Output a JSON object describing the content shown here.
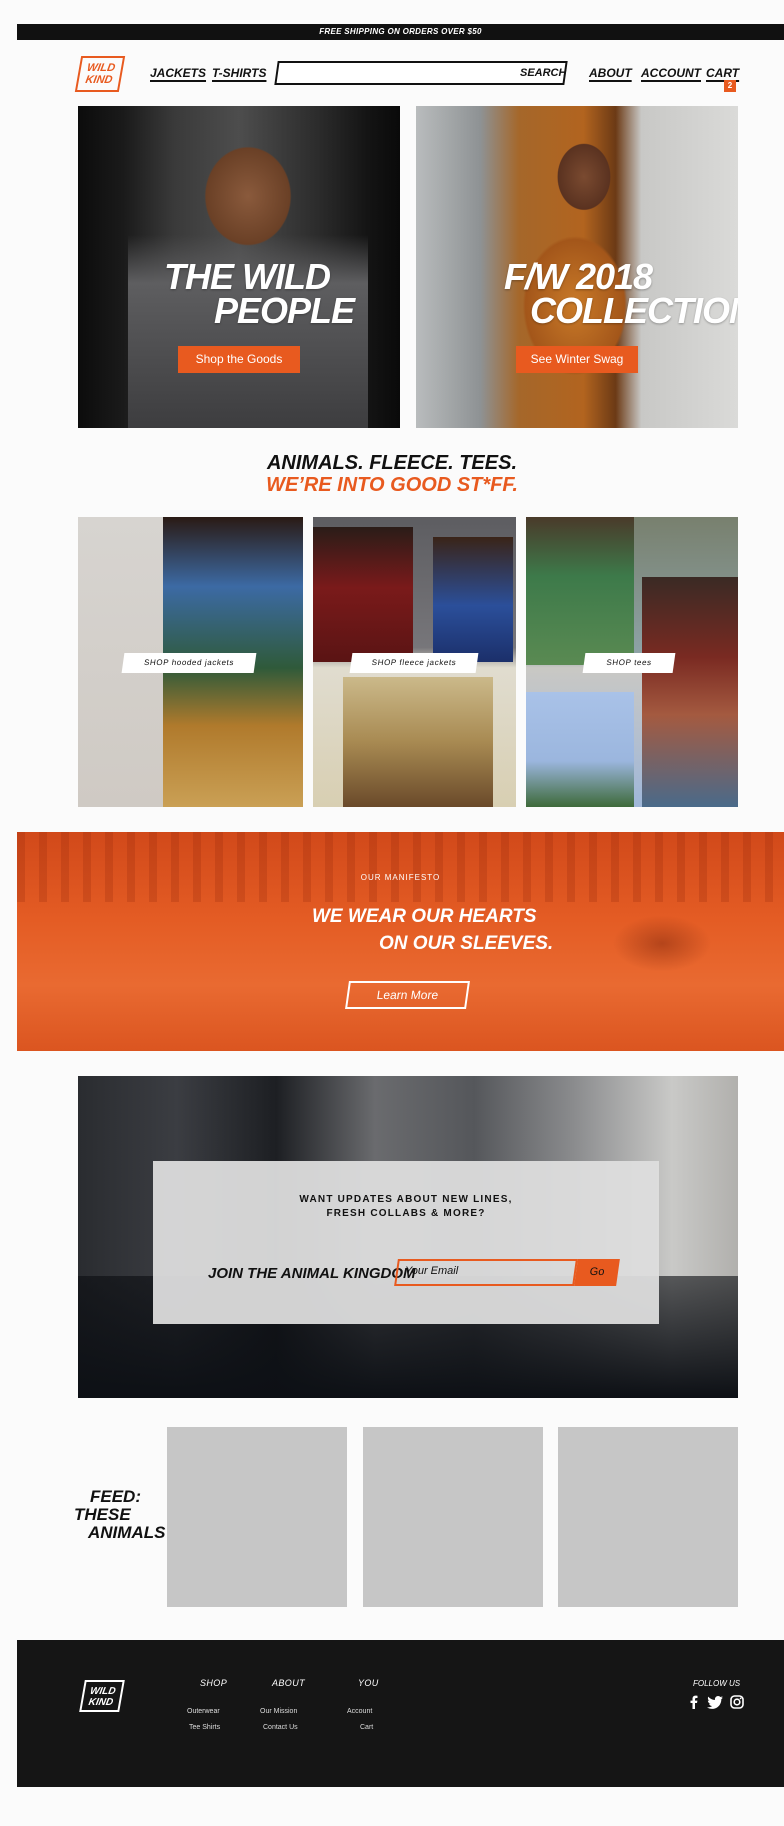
{
  "banner": "FREE SHIPPING ON ORDERS OVER $50",
  "header": {
    "logo": [
      "WILD",
      "KIND"
    ],
    "nav_left": [
      "JACKETS",
      "T-SHIRTS"
    ],
    "search_label": "SEARCH",
    "nav_right": [
      "ABOUT",
      "ACCOUNT",
      "CART"
    ],
    "cart_count": "2"
  },
  "hero": [
    {
      "title_line1": "THE WILD",
      "title_line2": "PEOPLE",
      "button": "Shop the Goods"
    },
    {
      "title_line1": "F/W 2018",
      "title_line2": "COLLECTION",
      "button": "See Winter Swag"
    }
  ],
  "tagline": {
    "line1": "ANIMALS. FLEECE. TEES.",
    "line2": "WE’RE INTO GOOD ST*FF."
  },
  "categories": [
    {
      "label": "SHOP hooded jackets"
    },
    {
      "label": "SHOP fleece jackets"
    },
    {
      "label": "SHOP tees"
    }
  ],
  "manifesto": {
    "eyebrow": "OUR MANIFESTO",
    "line1": "WE WEAR OUR HEARTS",
    "line2": "ON OUR SLEEVES.",
    "button": "Learn More"
  },
  "newsletter": {
    "question_line1": "WANT UPDATES ABOUT NEW LINES,",
    "question_line2": "FRESH COLLABS & MORE?",
    "join": "JOIN THE ANIMAL KINGDOM",
    "email_placeholder": "Your Email",
    "go": "Go"
  },
  "feed": {
    "line1": "FEED:",
    "line2": "THESE",
    "line3": "ANIMALS"
  },
  "footer": {
    "logo": [
      "WILD",
      "KIND"
    ],
    "columns": [
      {
        "heading": "SHOP",
        "links": [
          "Outerwear",
          "Tee Shirts"
        ]
      },
      {
        "heading": "ABOUT",
        "links": [
          "Our Mission",
          "Contact Us"
        ]
      },
      {
        "heading": "YOU",
        "links": [
          "Account",
          "Cart"
        ]
      }
    ],
    "follow": "FOLLOW US",
    "social_icons": [
      "facebook-icon",
      "twitter-icon",
      "instagram-icon"
    ]
  },
  "colors": {
    "accent": "#e85a1f",
    "dark": "#151515"
  }
}
